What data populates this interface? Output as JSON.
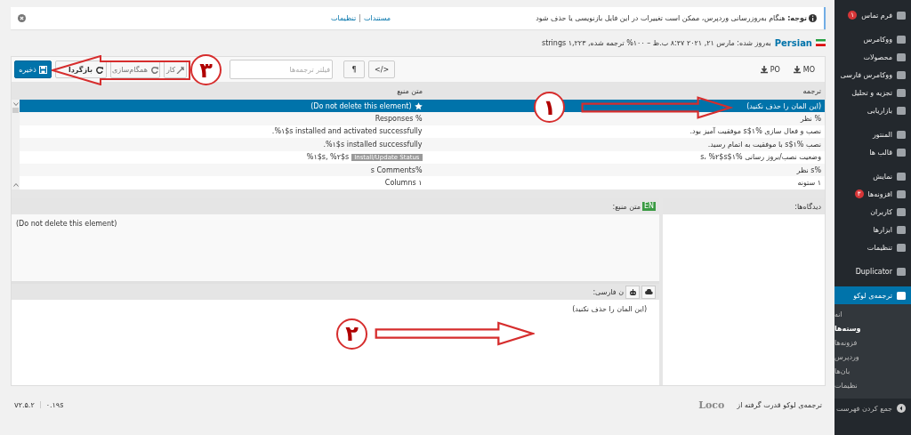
{
  "notice": {
    "label": "توجه:",
    "message": " هنگام به‌روزرسانی وردپرس، ممکن است تغییرات در این فایل بازنویسی یا حذف شود",
    "links": [
      "مستندات",
      "تنظیمات"
    ],
    "separator": "|"
  },
  "header": {
    "language": "Persian",
    "meta": "به‌روز شده: مارس ۲۱, ۲۰۲۱ ۸:۴۷ ب.ظ – ۱۰۰% ترجمه شده, ۱,۲۲۳ strings"
  },
  "toolbar": {
    "downloads": [
      "MO",
      "PO"
    ],
    "format_buttons": [
      "</>",
      "¶"
    ],
    "filter_placeholder": "فیلتر ترجمه‌ها",
    "buttons": [
      {
        "label": "کار",
        "kind": "auto",
        "disabled": true
      },
      {
        "label": "همگام‌سازی",
        "kind": "sync",
        "disabled": true
      },
      {
        "label": "بازگردا",
        "kind": "revert",
        "disabled": false
      },
      {
        "label": "ذخیره",
        "kind": "save",
        "disabled": false
      }
    ]
  },
  "table": {
    "columns": [
      "ترجمه",
      "متن منبع"
    ],
    "rows": [
      {
        "translation": "(این المان را حذف نکنید)",
        "source": "(Do not delete this element)",
        "starred": true,
        "selected": true
      },
      {
        "translation": "% نظر",
        "source": "% Responses",
        "starred": false,
        "selected": false
      },
      {
        "translation": "نصب و فعال سازی %۱$s موفقیت آمیز بود.",
        "source": "%۱$s installed and activated successfully.",
        "starred": false,
        "selected": false
      },
      {
        "translation": "نصب %۱$s با موفقیت به اتمام رسید.",
        "source": "%۱$s installed successfully.",
        "starred": false,
        "selected": false
      },
      {
        "translation": "وضعیت نصب/بروز رسانی %۱$s، %۲$s",
        "source": "%۱$s, %۲$s",
        "context": "Install/Update Status",
        "starred": false,
        "selected": false
      },
      {
        "translation": "%s نظر",
        "source": "%s Comments",
        "starred": false,
        "selected": false
      },
      {
        "translation": "۱ ستونه",
        "source": "۱ Columns",
        "starred": false,
        "selected": false
      }
    ]
  },
  "source_panel": {
    "title": "متن منبع:",
    "locale": "EN",
    "text": "(Do not delete this element)"
  },
  "target_panel": {
    "title": "ن فارسی:",
    "text": "(این المان را حذف نکنید)"
  },
  "comments_panel": {
    "title": "دیدگاه‌ها:"
  },
  "footer": {
    "credit": "ترجمه‌ی لوکو قدرت گرفته از",
    "logo": "Loco",
    "time": "۰.۱۹s",
    "version": "v۲.۵.۲"
  },
  "sidebar": {
    "items": [
      {
        "label": "فرم تماس",
        "badge": "۱",
        "selected": false
      },
      {
        "label": "ووکامرس",
        "selected": false
      },
      {
        "label": "محصولات",
        "selected": false
      },
      {
        "label": "ووکامرس فارسی",
        "selected": false
      },
      {
        "label": "تجزیه و تحلیل",
        "selected": false
      },
      {
        "label": "بازاریابی",
        "selected": false
      },
      {
        "label": "المنتور",
        "selected": false
      },
      {
        "label": "قالب ها",
        "selected": false
      },
      {
        "label": "نمایش",
        "selected": false
      },
      {
        "label": "افزونه‌ها",
        "badge": "۳",
        "selected": false
      },
      {
        "label": "کاربران",
        "selected": false
      },
      {
        "label": "ابزارها",
        "selected": false
      },
      {
        "label": "تنظیمات",
        "selected": false
      },
      {
        "label": "Duplicator",
        "selected": false
      },
      {
        "label": "ترجمه‌ی لوکو",
        "selected": true,
        "children": [
          {
            "label": "انه",
            "selected": false
          },
          {
            "label": "وسته‌ها",
            "selected": true
          },
          {
            "label": "فزونه‌ها",
            "selected": false
          },
          {
            "label": "وردپرس",
            "selected": false
          },
          {
            "label": "بان‌ها",
            "selected": false
          },
          {
            "label": "نظیمات",
            "selected": false
          }
        ]
      }
    ],
    "collapse": "جمع کردن فهرست"
  },
  "annotations": [
    {
      "number": "۱",
      "kind": "row"
    },
    {
      "number": "۲",
      "kind": "editor"
    },
    {
      "number": "۳",
      "kind": "save"
    }
  ]
}
